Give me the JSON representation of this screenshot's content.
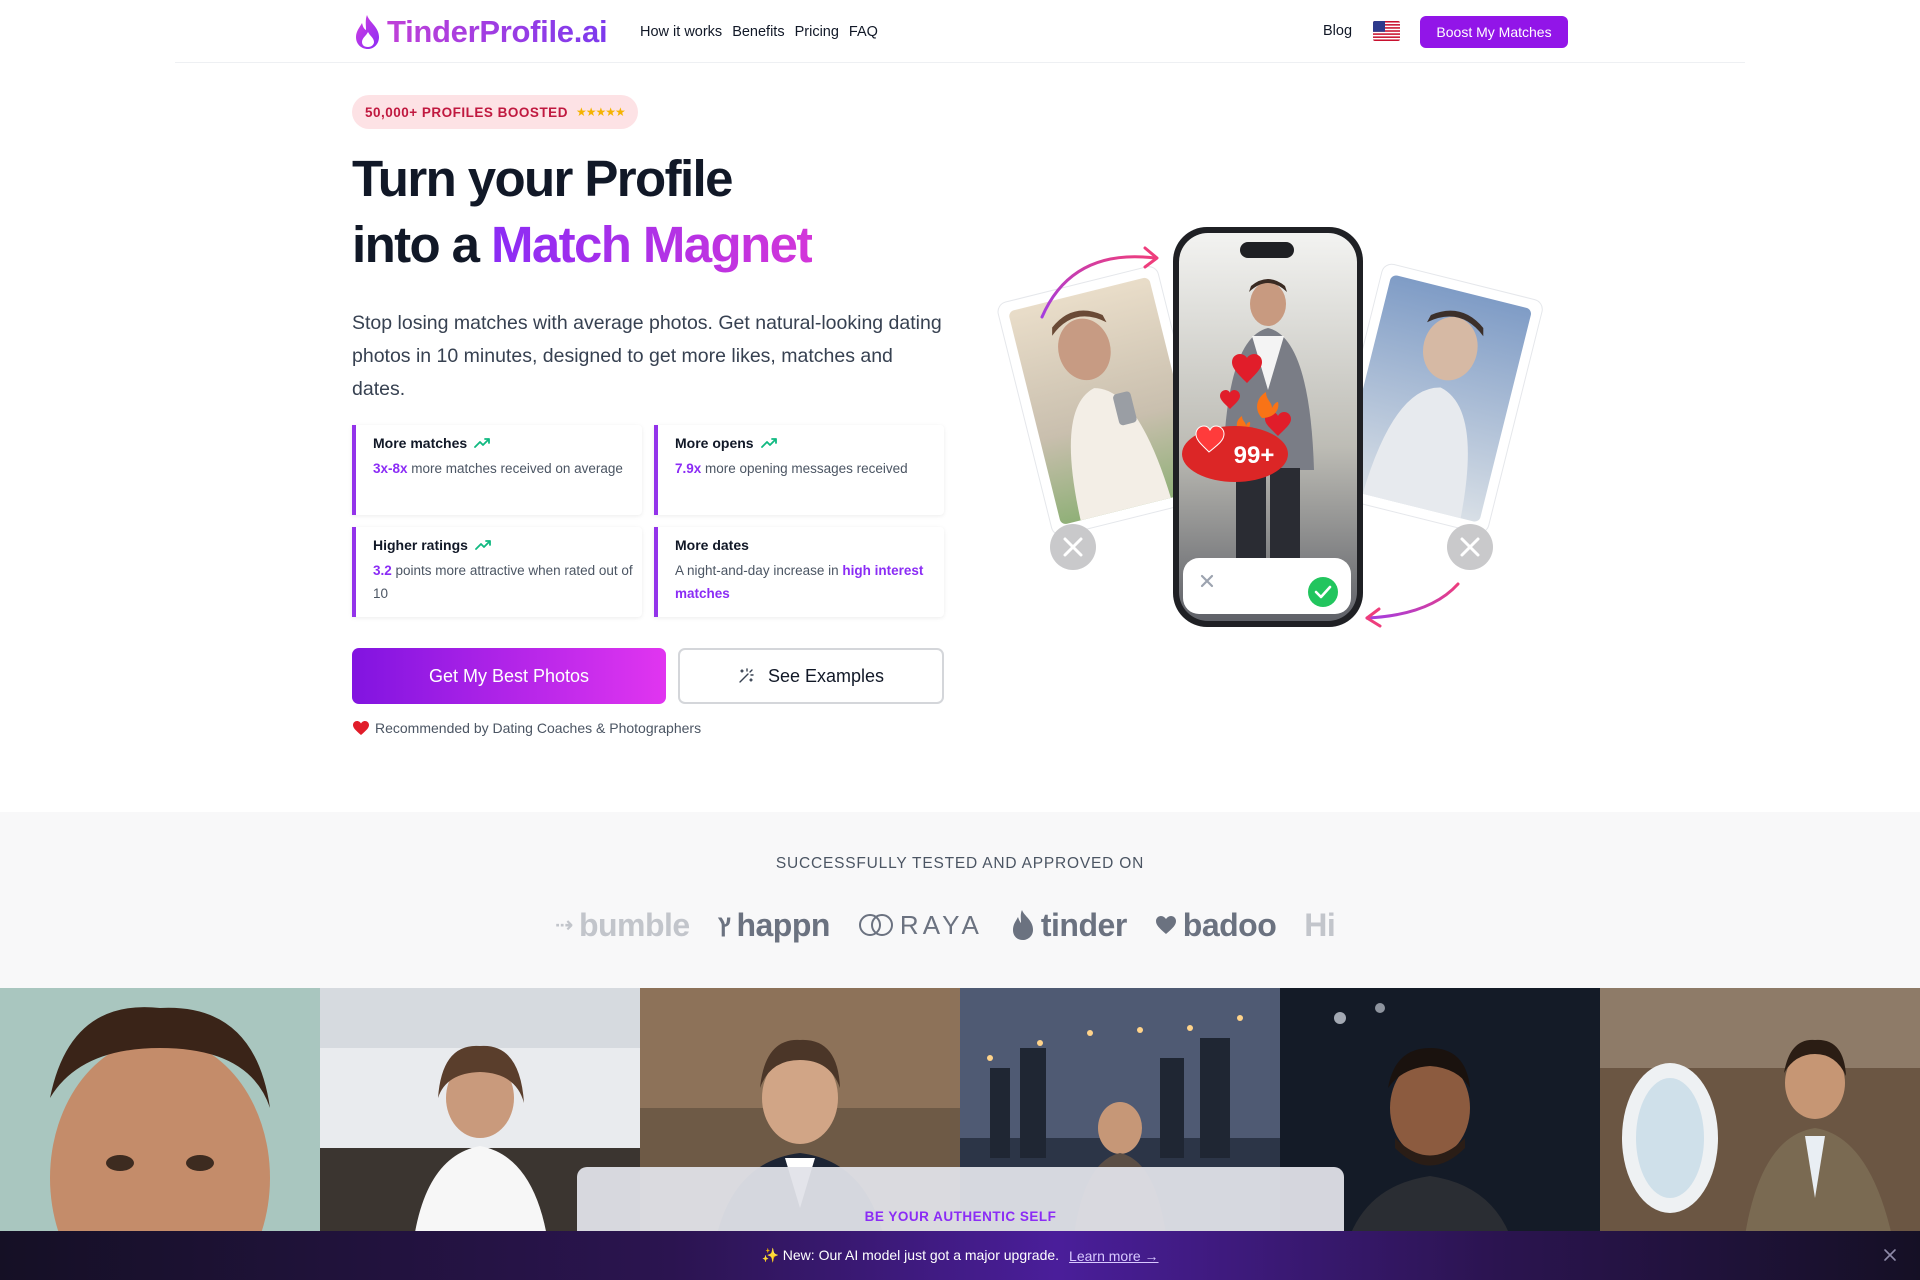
{
  "nav": {
    "logo": "TinderProfile.ai",
    "links": [
      "How it works",
      "Benefits",
      "Pricing",
      "FAQ"
    ],
    "blog": "Blog",
    "flag": "us-flag-icon",
    "cta": "Boost My Matches"
  },
  "hero": {
    "badge": "50,000+ PROFILES BOOSTED",
    "badge_stars": "★★★★★",
    "headline_line1": "Turn your Profile",
    "headline_line2_prefix": "into a ",
    "headline_accent": "Match Magnet",
    "subtitle": "Stop losing matches with average photos. Get natural-looking dating photos in 10 minutes, designed to get more likes, matches and dates.",
    "stats": [
      {
        "title": "More matches",
        "highlight": "3x-8x",
        "text": " more matches received on average"
      },
      {
        "title": "More opens",
        "highlight": "7.9x",
        "text": " more opening messages received"
      },
      {
        "title": "Higher ratings",
        "highlight": "3.2",
        "text": " points more attractive when rated out of 10"
      },
      {
        "title": "More dates",
        "text_prefix": "A night-and-day increase in ",
        "highlight": "high interest matches"
      }
    ],
    "primary_button": "Get My Best Photos",
    "secondary_button": "See Examples",
    "recommend": "Recommended by Dating Coaches & Photographers",
    "phone_badge": "99+"
  },
  "platforms": {
    "title": "SUCCESSFULLY TESTED AND APPROVED ON",
    "logos": [
      "bumble",
      "happn",
      "RAYA",
      "tinder",
      "badoo",
      "Hi"
    ]
  },
  "gallery": {
    "tagline": "BE YOUR AUTHENTIC SELF"
  },
  "banner": {
    "text": "✨ New: Our AI model just got a major upgrade.",
    "link": "Learn more →"
  },
  "colors": {
    "brand_purple": "#9215e8",
    "accent_gradient_start": "#8b2cf5",
    "accent_gradient_end": "#d336d9",
    "badge_bg": "#fde2e5",
    "badge_text": "#c0183f",
    "trend_green": "#10b981"
  }
}
